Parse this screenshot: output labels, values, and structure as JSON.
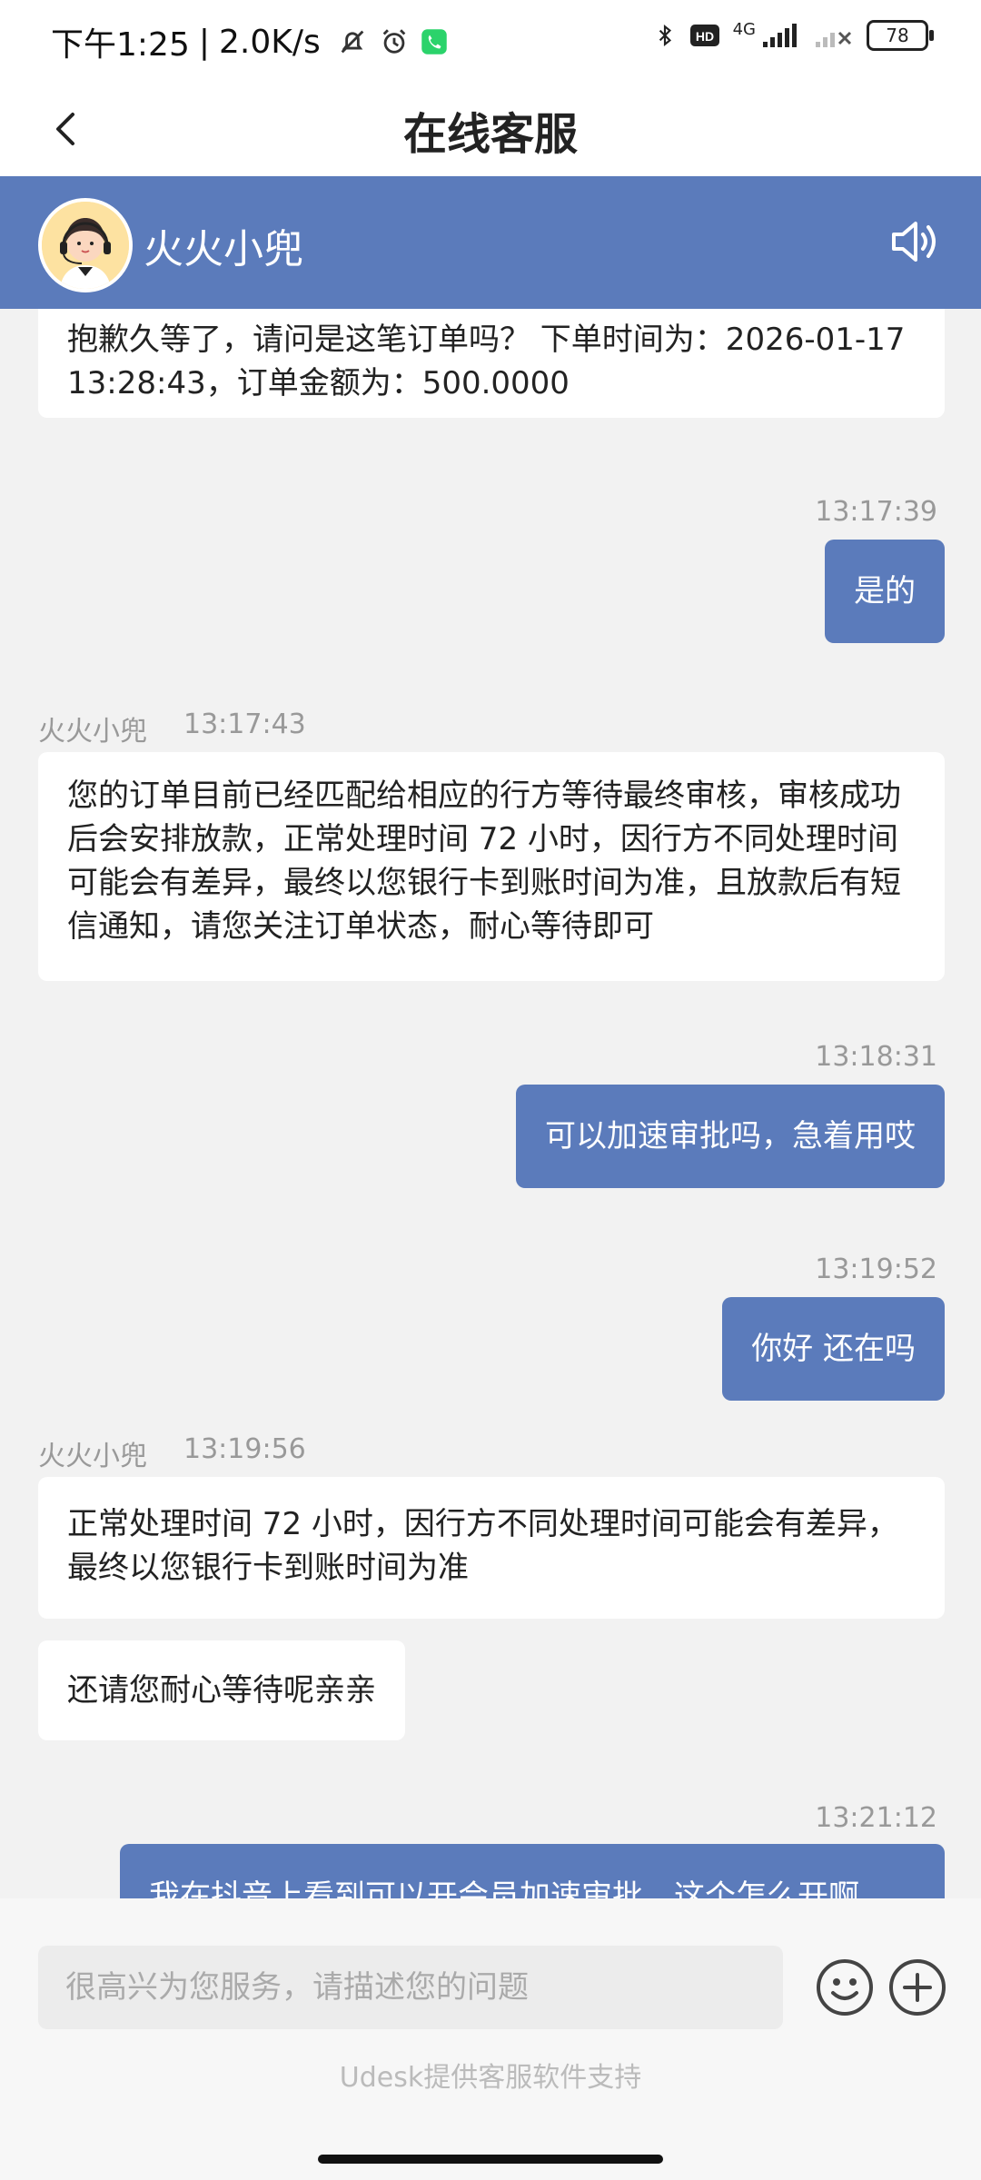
{
  "status_bar": {
    "time": "下午1:25",
    "speed": "2.0K/s",
    "network": "4G",
    "battery": "78"
  },
  "header": {
    "title": "在线客服"
  },
  "agent": {
    "name": "火火小兜"
  },
  "messages": {
    "m1": {
      "text": "抱歉久等了，请问是这笔订单吗？ 下单时间为：2026-01-17 13:28:43，订单金额为：500.0000"
    },
    "m2": {
      "time": "13:17:39",
      "text": "是的"
    },
    "m3": {
      "sender": "火火小兜",
      "time": "13:17:43",
      "text": "您的订单目前已经匹配给相应的行方等待最终审核，审核成功后会安排放款，正常处理时间 72 小时，因行方不同处理时间可能会有差异，最终以您银行卡到账时间为准，且放款后有短信通知，请您关注订单状态，耐心等待即可"
    },
    "m4": {
      "time": "13:18:31",
      "text": "可以加速审批吗，急着用哎"
    },
    "m5": {
      "time": "13:19:52",
      "text": "你好 还在吗"
    },
    "m6": {
      "sender": "火火小兜",
      "time": "13:19:56",
      "text": "正常处理时间 72 小时，因行方不同处理时间可能会有差异，最终以您银行卡到账时间为准"
    },
    "m7": {
      "text": "还请您耐心等待呢亲亲"
    },
    "m8": {
      "time": "13:21:12",
      "text": "我在抖音上看到可以开会员加速审批，这个怎么开啊"
    }
  },
  "footer": {
    "input_placeholder": "很高兴为您服务，请描述您的问题",
    "powered_by": "Udesk提供客服软件支持"
  },
  "colors": {
    "accent": "#5b7bbb",
    "background": "#f2f2f2"
  }
}
